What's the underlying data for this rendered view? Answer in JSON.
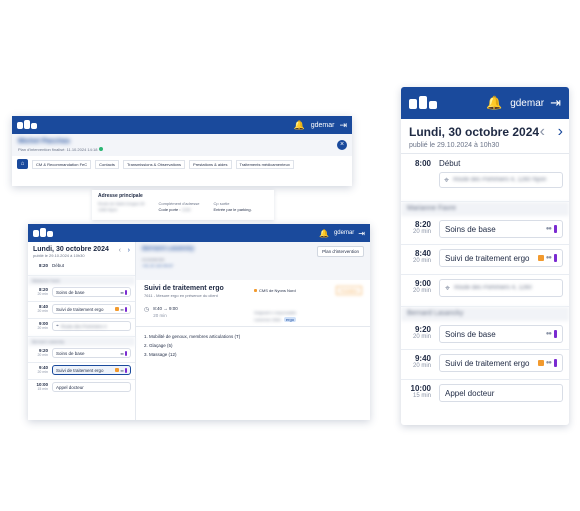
{
  "colors": {
    "primary": "#1a4a9c",
    "accent_orange": "#f29a2e",
    "accent_purple": "#7a2bd1",
    "online": "#2bb673"
  },
  "user": {
    "name": "gdemar"
  },
  "icons": [
    "logo",
    "bell-icon",
    "logout-icon",
    "home-icon",
    "close-icon",
    "location-pin-icon",
    "chevron-left-icon",
    "chevron-right-icon",
    "clock-icon",
    "people-icon"
  ],
  "desktop_back": {
    "patient_name": "Michel Pacchas",
    "subtitle": "Plan d'intervention finalisé: 11.10.2024 14:18",
    "tabs": [
      "CM & Recommandation FeC",
      "Contacts",
      "Transmissions & Observations",
      "Prestations & aides",
      "Traitements médicamenteux"
    ],
    "address_title": "Adresse principale",
    "address_lines": [
      "Route de Saint-Cergue 39",
      "1260 Nyon"
    ],
    "complement_label": "Complément d'adresse",
    "code_label": "Code porte :",
    "code_value": "1234",
    "access_label": "Cp sortie",
    "access_value": "Entrée par le parking."
  },
  "desktop_front": {
    "date_title": "Lundi, 30 octobre 2024",
    "published": "publié le 29.10.2024 à 10h30",
    "schedule": [
      {
        "time": "8:20",
        "label": "Début"
      },
      {
        "section": "Marianne Favre"
      },
      {
        "time": "8:20",
        "dur": "20 min",
        "label": "Soins de base"
      },
      {
        "time": "8:40",
        "dur": "20 min",
        "label": "Suivi de traitement ergo"
      },
      {
        "time": "9:00",
        "dur": "20 min",
        "label": "Route des Pommiers 4"
      },
      {
        "section": "Bernard Lasancky"
      },
      {
        "time": "9:20",
        "dur": "20 min",
        "label": "Soins de base"
      },
      {
        "time": "9:40",
        "dur": "20 min",
        "label": "Suivi de traitement ergo"
      },
      {
        "time": "10:00",
        "dur": "15 min",
        "label": "Appel docteur"
      }
    ],
    "detail": {
      "patient": "Bernard Lasancky",
      "plan_button": "Plan d'intervention",
      "phone_1": "0123456789",
      "phone_2": "+41 22 123 45 67",
      "title": "Suivi de traitement ergo",
      "subtitle": "7611 - Mesure ergo en présence du client",
      "org": "CMS de Nyons Nord",
      "badge": "Prestation",
      "time": "8:40 → 9:00",
      "duration": "20 min",
      "assignee_label": "Soignant·e responsable",
      "assignee": "Laurence Gillet",
      "assignee_badge": "ergo",
      "items": [
        "1. Mobilité de genoux, membres articulations (T)",
        "2. Glaçage (5)",
        "3. Massage (12)"
      ]
    }
  },
  "mobile": {
    "date_title": "Lundi, 30 octobre 2024",
    "published": "publié le 29.10.2024 à 10h30",
    "first_time": "8:00",
    "first_label": "Début",
    "first_address": "Route des Pommiers 4, 1260 Nyon",
    "section_1": "Marianne Favre",
    "section_2": "Bernard Lasancky",
    "rows": [
      {
        "time": "8:20",
        "dur": "20 min",
        "label": "Soins de base",
        "orange": false
      },
      {
        "time": "8:40",
        "dur": "20 min",
        "label": "Suivi de traitement ergo",
        "orange": true
      },
      {
        "time": "9:00",
        "dur": "20 min",
        "label": "Route des Pommiers 4, 1260",
        "orange": false
      },
      {
        "time": "9:20",
        "dur": "20 min",
        "label": "Soins de base",
        "orange": false
      },
      {
        "time": "9:40",
        "dur": "20 min",
        "label": "Suivi de traitement ergo",
        "orange": true
      },
      {
        "time": "10:00",
        "dur": "15 min",
        "label": "Appel docteur",
        "orange": false
      }
    ]
  }
}
